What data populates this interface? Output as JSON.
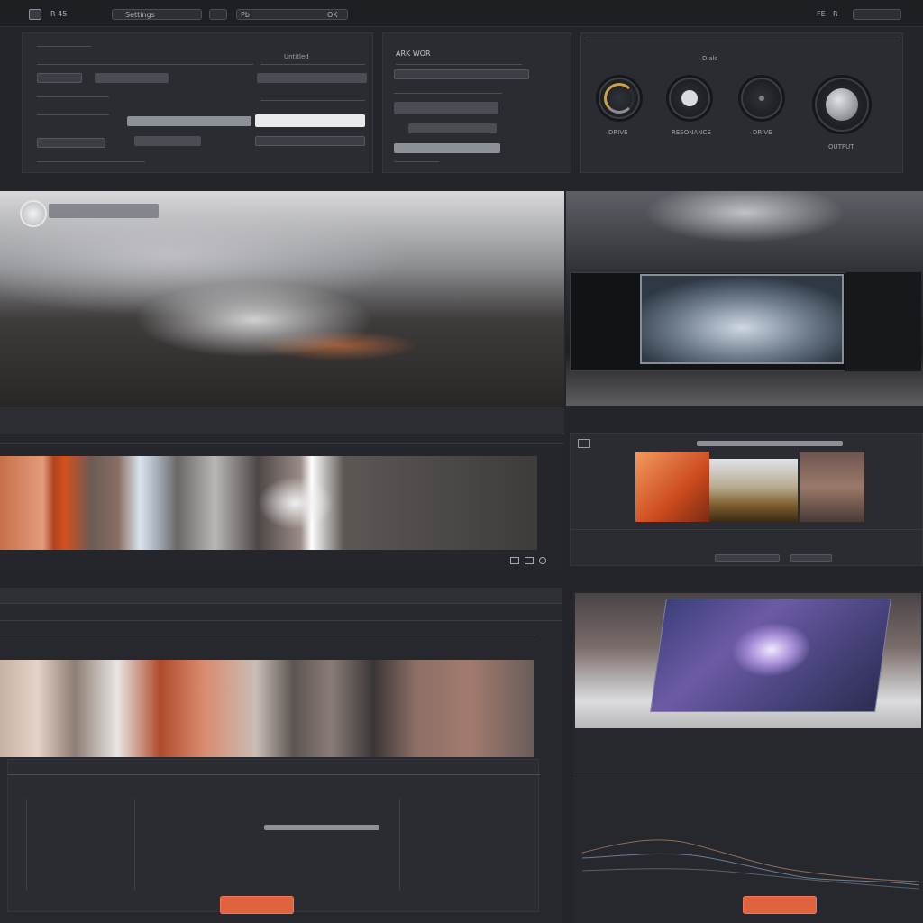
{
  "topbar": {
    "app_label": "R 45",
    "menu_a": "Settings",
    "menu_b": "Pb",
    "menu_c": "OK",
    "status_a": "FE",
    "status_b": "R"
  },
  "panel1": {
    "label_a": "Untitled"
  },
  "panel2": {
    "header": "ARK WOR"
  },
  "dials": {
    "dial1": "DRIVE",
    "dial2": "RESONANCE",
    "dial3": "DRIVE",
    "dial4": "OUTPUT",
    "title": "Dials"
  },
  "colors": {
    "accent": "#e0623f",
    "bg": "#23252a",
    "panel": "#2a2c31"
  },
  "icons": {
    "search": "search-icon",
    "gear": "gear-icon"
  }
}
